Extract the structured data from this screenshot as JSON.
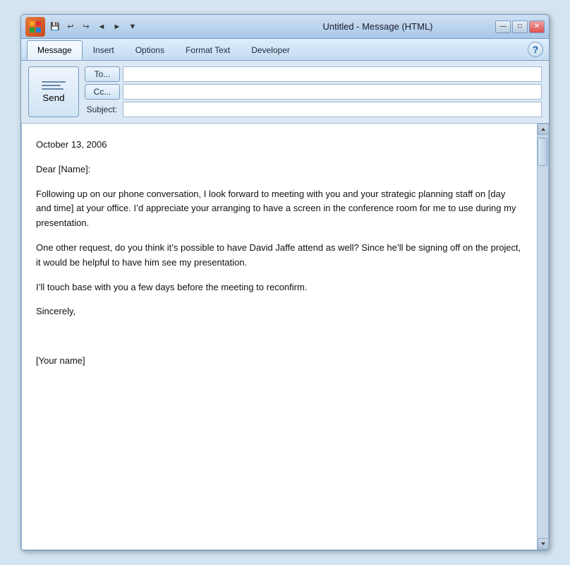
{
  "window": {
    "title": "Untitled - Message (HTML)",
    "title_parts": {
      "document": "Untitled",
      "separator": " - ",
      "app": "Message (HTML)"
    }
  },
  "quick_access": {
    "buttons": [
      "💾",
      "↩",
      "↪",
      "◄",
      "►",
      "▼"
    ]
  },
  "window_controls": {
    "minimize": "—",
    "restore": "□",
    "close": "✕"
  },
  "ribbon": {
    "tabs": [
      {
        "id": "message",
        "label": "Message",
        "active": true
      },
      {
        "id": "insert",
        "label": "Insert",
        "active": false
      },
      {
        "id": "options",
        "label": "Options",
        "active": false
      },
      {
        "id": "format-text",
        "label": "Format Text",
        "active": false
      },
      {
        "id": "developer",
        "label": "Developer",
        "active": false
      }
    ],
    "help_label": "?"
  },
  "compose": {
    "send_button_label": "Send",
    "to_button_label": "To...",
    "cc_button_label": "Cc...",
    "subject_label": "Subject:",
    "to_value": "",
    "cc_value": "",
    "subject_value": ""
  },
  "body": {
    "date": "October 13, 2006",
    "greeting": "Dear [Name]:",
    "paragraph1": "Following up on our phone conversation, I look forward to meeting with you and your strategic planning staff on [day and time] at your office. I’d appreciate your arranging to have a screen in the conference room for me to use during my presentation.",
    "paragraph2": "One other request, do you think it’s possible to have David Jaffe attend as well? Since he’ll be signing off on the project, it would be helpful to have him see my presentation.",
    "paragraph3": "I’ll touch base with you a few days before the meeting to reconfirm.",
    "closing": "Sincerely,",
    "signature": "[Your name]"
  }
}
